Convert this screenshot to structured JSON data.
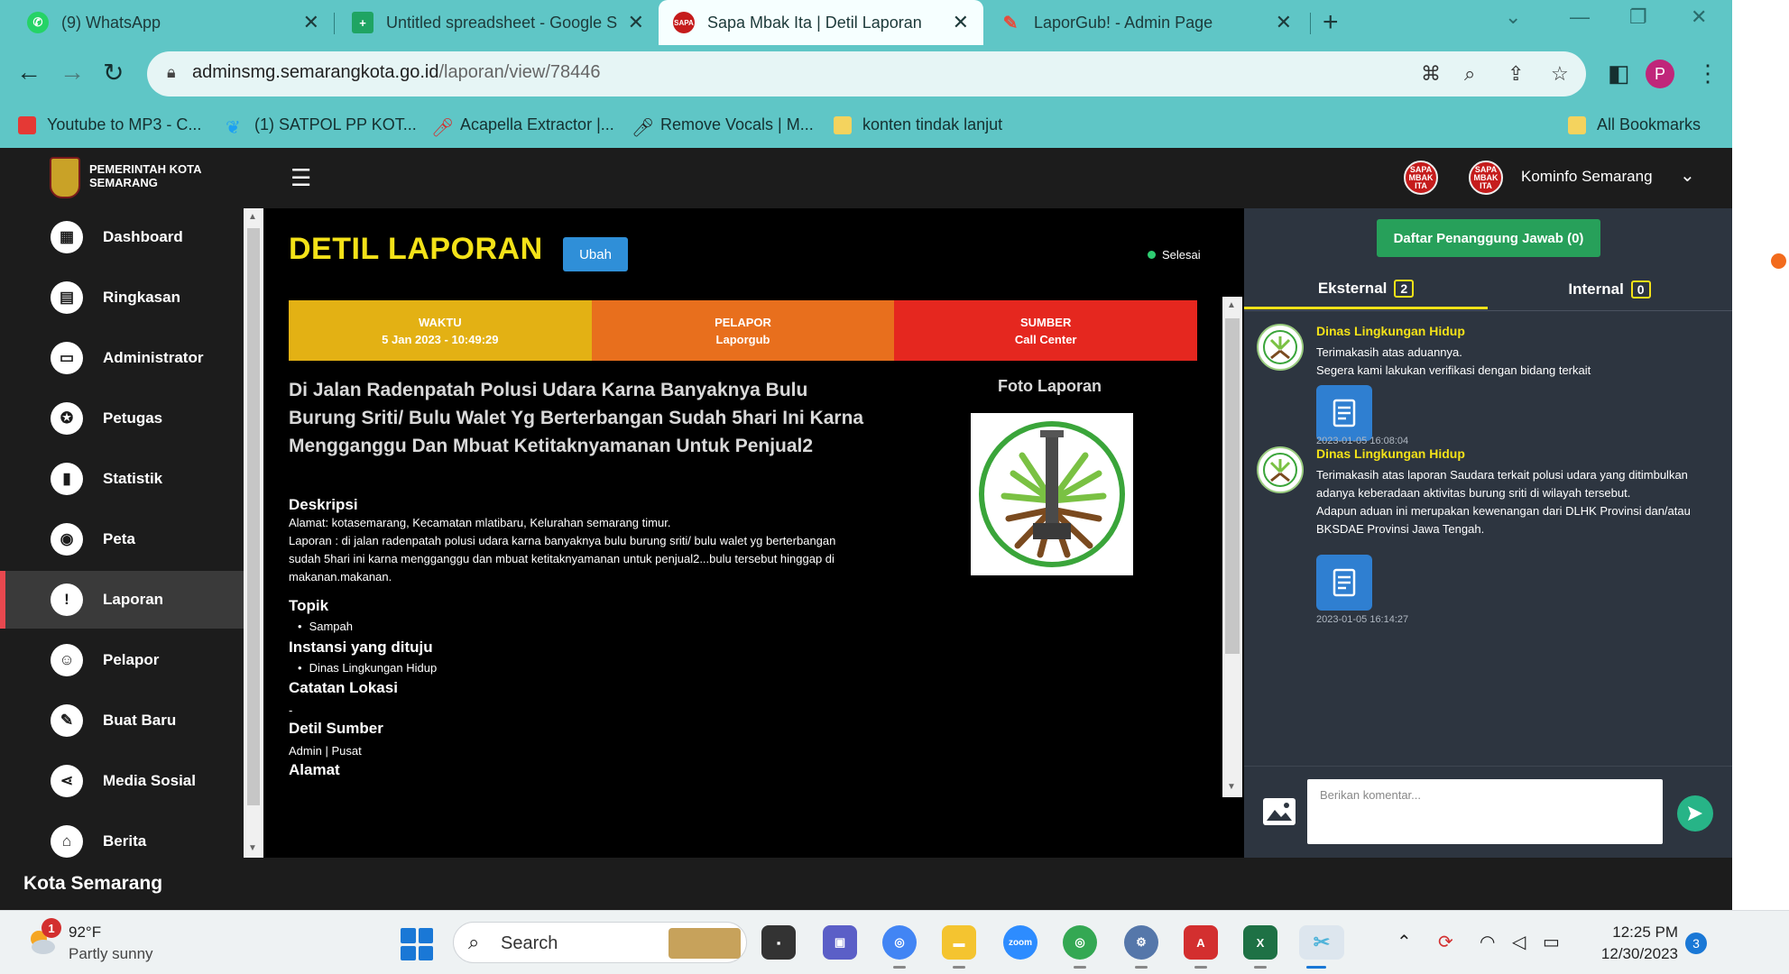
{
  "browser": {
    "tabs": [
      {
        "title": "(9) WhatsApp",
        "icon": "whatsapp-icon",
        "color": "#25d366",
        "active": false
      },
      {
        "title": "Untitled spreadsheet - Google S",
        "icon": "sheets-icon",
        "color": "#1fa463",
        "active": false
      },
      {
        "title": "Sapa Mbak Ita | Detil Laporan",
        "icon": "sapa-mbak-ita-icon",
        "color": "#c51c1c",
        "active": true
      },
      {
        "title": "LaporGub! - Admin Page",
        "icon": "laporgub-icon",
        "color": "#e74c3c",
        "active": false
      }
    ],
    "url_host": "adminsmg.semarangkota.go.id",
    "url_path": "/laporan/view/78446",
    "profile_initial": "P",
    "bookmarks": [
      {
        "label": "Youtube to MP3 - C...",
        "icon": "download-bookmark-icon",
        "color": "#e53935"
      },
      {
        "label": "(1) SATPOL PP KOT...",
        "icon": "twitter-icon",
        "color": "#1da1f2"
      },
      {
        "label": "Acapella Extractor |...",
        "icon": "mic-red-icon",
        "color": "#d32f2f"
      },
      {
        "label": "Remove Vocals | M...",
        "icon": "mic-icon",
        "color": "#222222"
      },
      {
        "label": "konten tindak lanjut",
        "icon": "folder-icon",
        "color": "#f4d35e"
      }
    ],
    "all_bookmarks": "All Bookmarks"
  },
  "app": {
    "org_name": "PEMERINTAH KOTA SEMARANG",
    "user_name": "Kominfo Semarang",
    "footer": "Kota Semarang",
    "sidebar": [
      {
        "label": "Dashboard",
        "icon": "dashboard-icon",
        "glyph": "▦"
      },
      {
        "label": "Ringkasan",
        "icon": "calendar-icon",
        "glyph": "▤"
      },
      {
        "label": "Administrator",
        "icon": "monitor-icon",
        "glyph": "▭"
      },
      {
        "label": "Petugas",
        "icon": "badge-icon",
        "glyph": "✪"
      },
      {
        "label": "Statistik",
        "icon": "bar-chart-icon",
        "glyph": "▮"
      },
      {
        "label": "Peta",
        "icon": "map-pin-icon",
        "glyph": "◉"
      },
      {
        "label": "Laporan",
        "icon": "alert-icon",
        "glyph": "!"
      },
      {
        "label": "Pelapor",
        "icon": "users-icon",
        "glyph": "☺"
      },
      {
        "label": "Buat Baru",
        "icon": "pencil-icon",
        "glyph": "✎"
      },
      {
        "label": "Media Sosial",
        "icon": "share-icon",
        "glyph": "⋖"
      },
      {
        "label": "Berita",
        "icon": "building-icon",
        "glyph": "⌂"
      }
    ],
    "active_sidebar": "Laporan"
  },
  "report": {
    "heading": "DETIL LAPORAN",
    "edit_label": "Ubah",
    "status": "Selesai",
    "waktu_label": "WAKTU",
    "waktu_value": "5 Jan 2023 - 10:49:29",
    "pelapor_label": "PELAPOR",
    "pelapor_value": "Laporgub",
    "sumber_label": "SUMBER",
    "sumber_value": "Call Center",
    "title": "Di Jalan Radenpatah Polusi Udara Karna Banyaknya Bulu Burung Sriti/ Bulu Walet Yg Berterbangan Sudah 5hari Ini Karna Mengganggu Dan Mbuat Ketitaknyamanan Untuk Penjual2",
    "foto_label": "Foto Laporan",
    "deskripsi_label": "Deskripsi",
    "deskripsi_alamat": "Alamat: kotasemarang, Kecamatan mlatibaru, Kelurahan semarang timur.",
    "deskripsi_laporan": "Laporan : di jalan radenpatah polusi udara karna banyaknya bulu burung sriti/ bulu walet yg berterbangan sudah 5hari ini karna mengganggu dan mbuat ketitaknyamanan untuk penjual2...bulu tersebut hinggap di makanan.makanan.",
    "topik_label": "Topik",
    "topik_value": "Sampah",
    "instansi_label": "Instansi yang dituju",
    "instansi_value": "Dinas Lingkungan Hidup",
    "catatan_label": "Catatan Lokasi",
    "catatan_value": "-",
    "detil_sumber_label": "Detil Sumber",
    "detil_sumber_value": "Admin | Pusat",
    "alamat_label": "Alamat"
  },
  "responses": {
    "button_label": "Daftar Penanggung Jawab (0)",
    "tabs": [
      {
        "label": "Eksternal",
        "count": "2"
      },
      {
        "label": "Internal",
        "count": "0"
      }
    ],
    "messages": [
      {
        "sender": "Dinas Lingkungan Hidup",
        "lines": [
          "Terimakasih atas aduannya.",
          "Segera kami lakukan verifikasi dengan bidang terkait"
        ],
        "time": "2023-01-05 16:08:04"
      },
      {
        "sender": "Dinas Lingkungan Hidup",
        "lines": [
          "Terimakasih atas laporan Saudara terkait polusi udara yang ditimbulkan adanya keberadaan aktivitas burung sriti di wilayah tersebut.",
          "Adapun aduan ini merupakan kewenangan dari DLHK Provinsi dan/atau BKSDAE Provinsi Jawa Tengah."
        ],
        "time": "2023-01-05 16:14:27"
      }
    ],
    "comment_placeholder": "Berikan komentar..."
  },
  "taskbar": {
    "weather_temp": "92°F",
    "weather_cond": "Partly sunny",
    "weather_badge": "1",
    "search_label": "Search",
    "time": "12:25 PM",
    "date": "12/30/2023",
    "notif_count": "3",
    "apps": [
      {
        "name": "terminal-app-icon",
        "color": "#333333",
        "glyph": "▪"
      },
      {
        "name": "meet-app-icon",
        "color": "#5b5fc7",
        "glyph": "▣"
      },
      {
        "name": "chrome-app-icon",
        "color": "#4285f4",
        "glyph": "◎"
      },
      {
        "name": "file-explorer-app-icon",
        "color": "#f4c430",
        "glyph": "▬"
      },
      {
        "name": "zoom-app-icon",
        "color": "#2d8cff",
        "glyph": "zoom"
      },
      {
        "name": "chrome-profile-app-icon",
        "color": "#34a853",
        "glyph": "◎"
      },
      {
        "name": "settings-app-icon",
        "color": "#5577aa",
        "glyph": "⚙"
      },
      {
        "name": "acrobat-app-icon",
        "color": "#d32f2f",
        "glyph": "A"
      },
      {
        "name": "excel-app-icon",
        "color": "#1e7145",
        "glyph": "X"
      },
      {
        "name": "snipping-tool-app-icon",
        "color": "#4fb3d9",
        "glyph": "✂"
      }
    ]
  }
}
